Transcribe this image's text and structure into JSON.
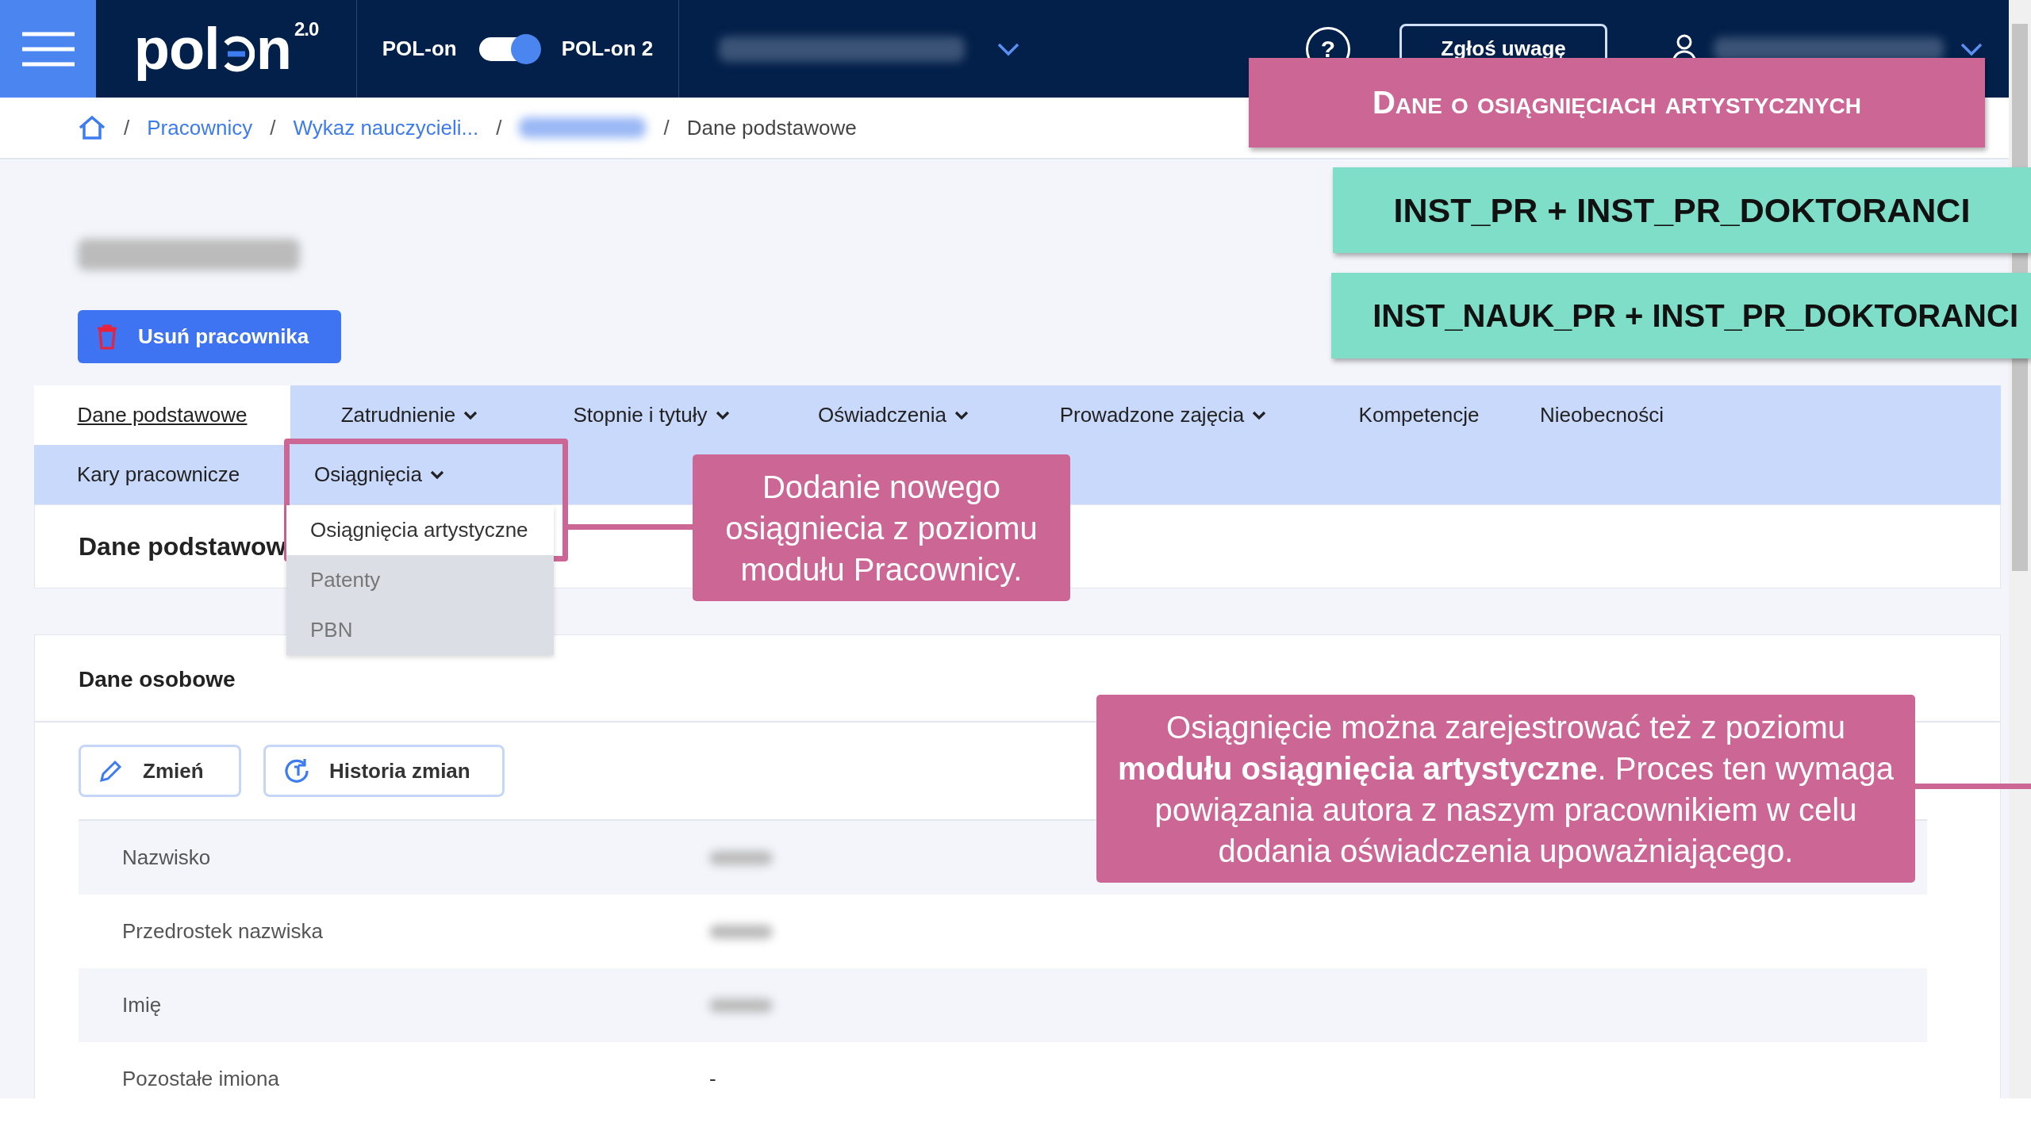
{
  "header": {
    "logo": "pol",
    "logo_tail": "n",
    "logo_version": "2.0",
    "toggle": {
      "left_label": "POL-on",
      "right_label": "POL-on 2",
      "on": true
    },
    "help": "?",
    "report_button": "Zgłoś uwagę"
  },
  "breadcrumb": [
    {
      "kind": "link",
      "separator": "/",
      "label": "Pracownicy"
    },
    {
      "kind": "link",
      "separator": "/",
      "label": "Wykaz nauczycieli..."
    },
    {
      "kind": "redacted",
      "separator": "/"
    },
    {
      "kind": "current",
      "separator": "/",
      "label": "Dane podstawowe"
    }
  ],
  "delete_button": "Usuń pracownika",
  "tab_rows": [
    [
      {
        "label": "Dane podstawowe",
        "selected": true,
        "dropdown": false
      },
      {
        "label": "Zatrudnienie",
        "selected": false,
        "dropdown": true
      },
      {
        "label": "Stopnie i tytuły",
        "selected": false,
        "dropdown": true
      },
      {
        "label": "Oświadczenia",
        "selected": false,
        "dropdown": true
      },
      {
        "label": "Prowadzone zajęcia",
        "selected": false,
        "dropdown": true
      },
      {
        "label": "Kompetencje",
        "selected": false,
        "dropdown": false
      },
      {
        "label": "Nieobecności",
        "selected": false,
        "dropdown": false
      }
    ],
    [
      {
        "label": "Kary pracownicze",
        "selected": false,
        "dropdown": false
      },
      {
        "label": "Osiągnięcia",
        "selected": false,
        "dropdown": true
      }
    ]
  ],
  "dropdown_menu": [
    {
      "label": "Osiągnięcia artystyczne",
      "selected": true
    },
    {
      "label": "Patenty",
      "selected": false
    },
    {
      "label": "PBN",
      "selected": false
    }
  ],
  "section_title": "Dane podstawow",
  "personal": {
    "title": "Dane osobowe",
    "buttons": [
      {
        "kind": "edit",
        "label": "Zmień"
      },
      {
        "kind": "history",
        "label": "Historia zmian"
      }
    ],
    "rows": [
      {
        "label": "Nazwisko",
        "redacted": true
      },
      {
        "label": "Przedrostek nazwiska",
        "redacted": true
      },
      {
        "label": "Imię",
        "redacted": true
      },
      {
        "label": "Pozostałe imiona",
        "value": "-",
        "redacted": false
      }
    ]
  },
  "annotations": [
    {
      "kind": "title",
      "text": "Dane o osiągnięciach artystycznych"
    },
    {
      "kind": "role",
      "text": "INST_PR + INST_PR_DOKTORANCI"
    },
    {
      "kind": "role",
      "text": "INST_NAUK_PR + INST_PR_DOKTORANCI"
    },
    {
      "kind": "callout",
      "text": "Dodanie nowego osiągniecia z poziomu modułu Pracownicy."
    },
    {
      "kind": "callout",
      "text": "Osiągnięcie można zarejestrować też  z poziomu **modułu osiągnięcia artystyczne**. Proces ten wymaga powiązania autora z naszym pracownikiem w celu dodania oświadczenia upoważniającego."
    }
  ]
}
